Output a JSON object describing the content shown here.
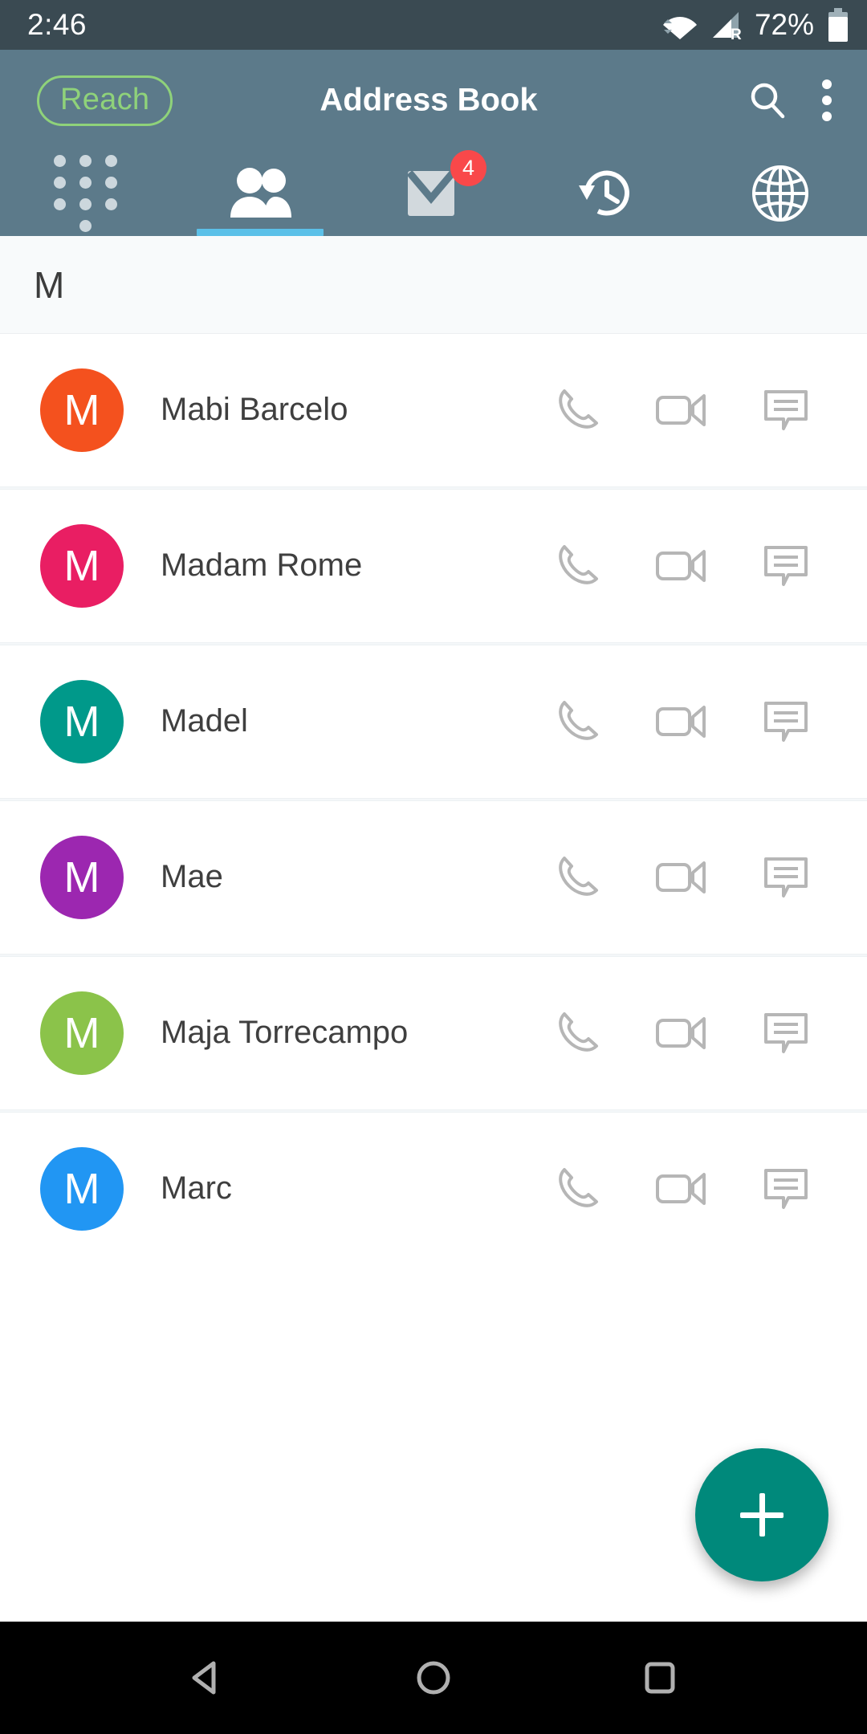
{
  "status_bar": {
    "time": "2:46",
    "battery_percent": "72%",
    "icons": [
      "wifi-icon",
      "cellular-signal-roaming-icon",
      "battery-icon"
    ],
    "roaming_label": "R",
    "background": "#3a4a52"
  },
  "app_bar": {
    "logo_label": "Reach",
    "logo_color": "#8fd27a",
    "title": "Address Book",
    "background": "#5c7a8a",
    "actions": [
      {
        "name": "search-icon",
        "label": "Search"
      },
      {
        "name": "overflow-menu-icon",
        "label": "More options"
      }
    ]
  },
  "tabs": {
    "active_index": 1,
    "indicator_color": "#5bc0e8",
    "items": [
      {
        "name": "tab-dialpad",
        "icon": "dialpad-icon",
        "label": "Dialpad",
        "badge": null
      },
      {
        "name": "tab-contacts",
        "icon": "contacts-icon",
        "label": "Contacts",
        "badge": null
      },
      {
        "name": "tab-messages",
        "icon": "mail-icon",
        "label": "Messages",
        "badge": "4"
      },
      {
        "name": "tab-history",
        "icon": "history-icon",
        "label": "History",
        "badge": null
      },
      {
        "name": "tab-web",
        "icon": "globe-icon",
        "label": "Web",
        "badge": null
      }
    ],
    "badge_color": "#f9484a"
  },
  "list": {
    "section_letter": "M",
    "row_actions": [
      {
        "name": "call-action-icon",
        "label": "Call"
      },
      {
        "name": "video-call-action-icon",
        "label": "Video call"
      },
      {
        "name": "message-action-icon",
        "label": "Message"
      }
    ],
    "contacts": [
      {
        "initial": "M",
        "name": "Mabi Barcelo",
        "color": "#f4511e"
      },
      {
        "initial": "M",
        "name": "Madam Rome",
        "color": "#e91e63"
      },
      {
        "initial": "M",
        "name": "Madel",
        "color": "#00998a"
      },
      {
        "initial": "M",
        "name": "Mae",
        "color": "#9c27b0"
      },
      {
        "initial": "M",
        "name": "Maja Torrecampo",
        "color": "#8bc34a"
      },
      {
        "initial": "M",
        "name": "Marc",
        "color": "#2196f3"
      }
    ]
  },
  "fab": {
    "name": "add-contact-fab",
    "icon": "plus-icon",
    "color": "#00897b"
  },
  "nav_bar": {
    "background": "#000000",
    "buttons": [
      {
        "name": "nav-back-button",
        "icon": "back-triangle-icon"
      },
      {
        "name": "nav-home-button",
        "icon": "home-circle-icon"
      },
      {
        "name": "nav-recents-button",
        "icon": "recents-square-icon"
      }
    ]
  }
}
